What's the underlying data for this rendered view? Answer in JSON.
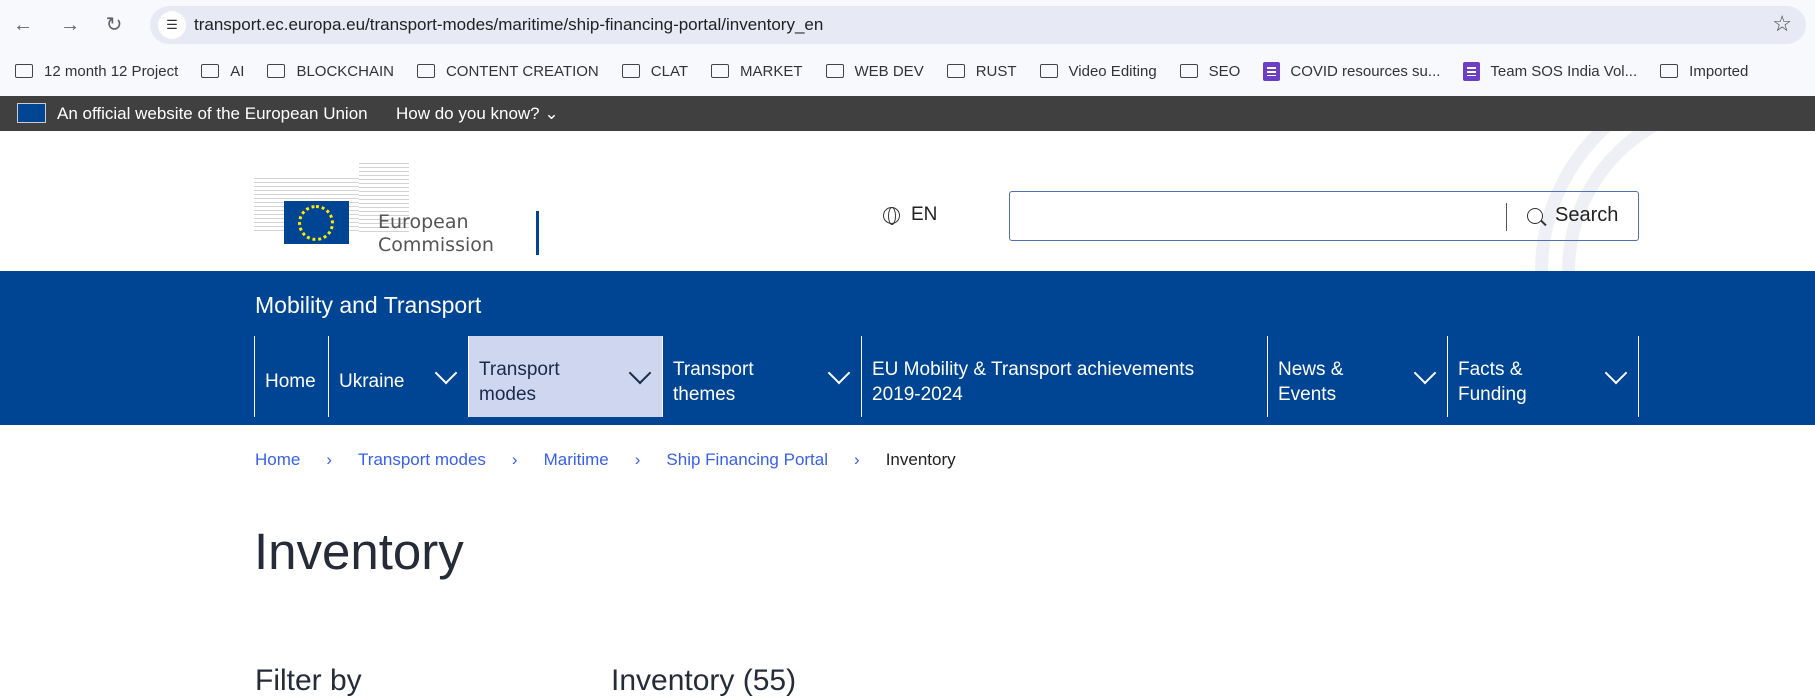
{
  "browser": {
    "url": "transport.ec.europa.eu/transport-modes/maritime/ship-financing-portal/inventory_en",
    "bookmarks": [
      {
        "label": "12 month 12 Project",
        "icon": "folder-icon"
      },
      {
        "label": "AI",
        "icon": "folder-icon"
      },
      {
        "label": "BLOCKCHAIN",
        "icon": "folder-icon"
      },
      {
        "label": "CONTENT CREATION",
        "icon": "folder-icon"
      },
      {
        "label": "CLAT",
        "icon": "folder-icon"
      },
      {
        "label": "MARKET",
        "icon": "folder-icon"
      },
      {
        "label": "WEB DEV",
        "icon": "folder-icon"
      },
      {
        "label": "RUST",
        "icon": "folder-icon"
      },
      {
        "label": "Video Editing",
        "icon": "folder-icon"
      },
      {
        "label": "SEO",
        "icon": "folder-icon"
      },
      {
        "label": "COVID resources su...",
        "icon": "sheets-icon"
      },
      {
        "label": "Team SOS India Vol...",
        "icon": "sheets-icon"
      },
      {
        "label": "Imported",
        "icon": "folder-icon"
      }
    ]
  },
  "eu_bar": {
    "official": "An official website of the European Union",
    "how": "How do you know?"
  },
  "header": {
    "logo_line1": "European",
    "logo_line2": "Commission",
    "lang": "EN",
    "search_label": "Search",
    "search_value": ""
  },
  "site_name": "Mobility and Transport",
  "menu": [
    {
      "l1": "Home",
      "l2": "",
      "chev": false,
      "w": 74
    },
    {
      "l1": "Ukraine",
      "l2": "",
      "chev": true,
      "w": 140
    },
    {
      "l1": "Transport",
      "l2": "modes",
      "chev": true,
      "active": true,
      "w": 194
    },
    {
      "l1": "Transport",
      "l2": "themes",
      "chev": true,
      "w": 199
    },
    {
      "l1": "EU Mobility & Transport achievements",
      "l2": "2019-2024",
      "chev": false,
      "w": 406
    },
    {
      "l1": "News &",
      "l2": "Events",
      "chev": true,
      "w": 180
    },
    {
      "l1": "Facts &",
      "l2": "Funding",
      "chev": true,
      "w": 191
    }
  ],
  "breadcrumb": [
    "Home",
    "Transport modes",
    "Maritime",
    "Ship Financing Portal"
  ],
  "breadcrumb_current": "Inventory",
  "page_title": "Inventory",
  "filter_heading": "Filter by",
  "list_heading": "Inventory (55)",
  "colors": {
    "eu_blue": "#004494",
    "link": "#3860ed",
    "active_menu": "#cfd6ef",
    "top_bar": "#404040"
  }
}
